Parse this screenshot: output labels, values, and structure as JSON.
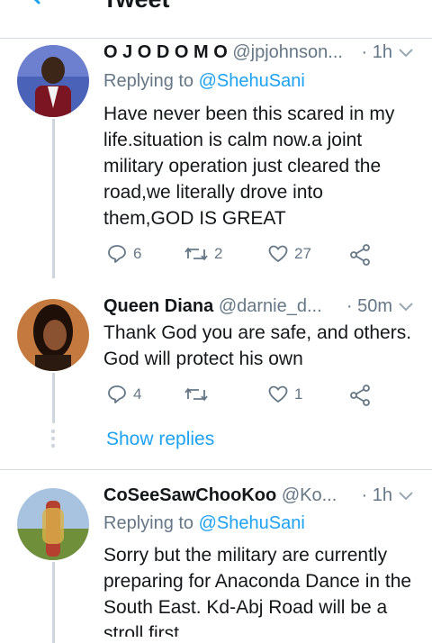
{
  "header": {
    "title": "Tweet"
  },
  "tweets": [
    {
      "name": "O J O D O M O",
      "handle": "@jpjohnson...",
      "time": "· 1h",
      "replying_label": "Replying to",
      "replying_to": "@ShehuSani",
      "text": "Have never been this scared in my life.situation is calm now.a joint military operation just cleared the road,we literally drove into them,GOD IS GREAT",
      "replies": "6",
      "retweets": "2",
      "likes": "27"
    },
    {
      "name": "Queen Diana",
      "handle": "@darnie_d...",
      "time": "· 50m",
      "text": "Thank God you are safe, and others. God will protect his own",
      "replies": "4",
      "retweets": "",
      "likes": "1",
      "show_replies": "Show replies"
    },
    {
      "name": "CoSeeSawChooKoo",
      "handle": "@Ko...",
      "time": "· 1h",
      "replying_label": "Replying to",
      "replying_to": "@ShehuSani",
      "text": "Sorry but the military are currently preparing for Anaconda Dance in the South East. Kd-Abj Road will be a stroll first..."
    }
  ],
  "colors": {
    "accent": "#1da1f2",
    "muted": "#657786",
    "text": "#14171a",
    "divider": "#d5dce2"
  },
  "icons": [
    "back-arrow-icon",
    "reply-icon",
    "retweet-icon",
    "like-icon",
    "share-icon",
    "chevron-down-icon"
  ]
}
